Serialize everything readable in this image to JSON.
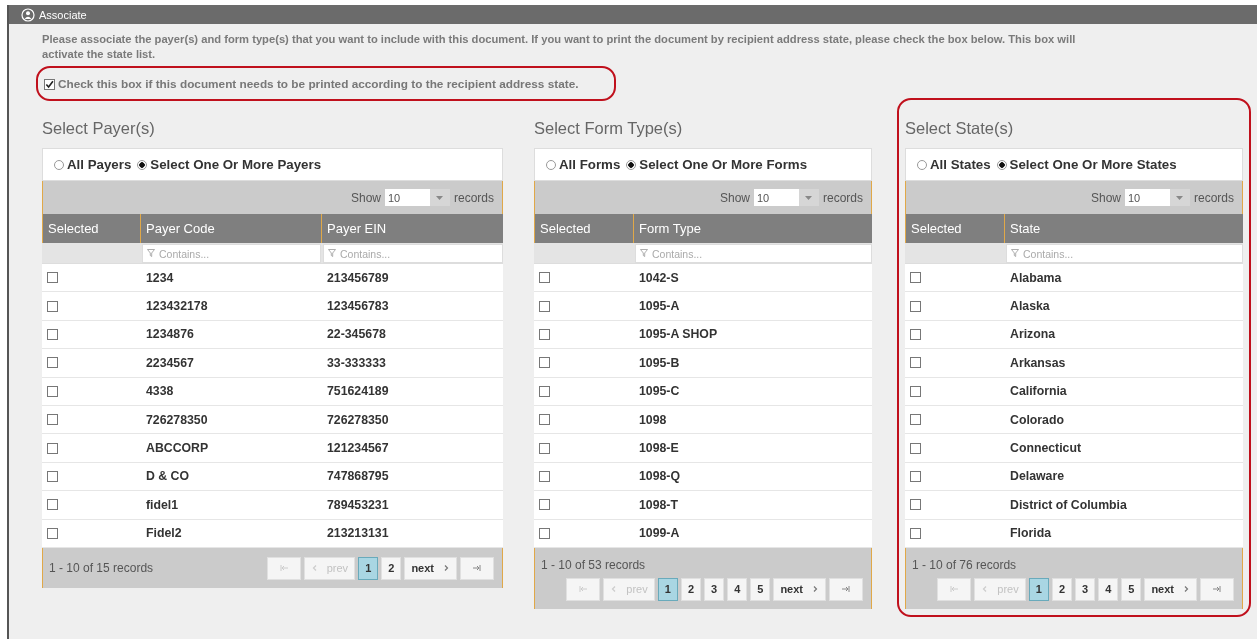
{
  "header": {
    "title": "Associate"
  },
  "instructions": "Please associate the payer(s) and form type(s) that you want to include with this document. If you want to print the document by recipient address state, please check the box below. This box will activate the state list.",
  "state_print_option": {
    "label": "Check this box if this document needs to be printed according to the recipient address state.",
    "checked": true,
    "highlighted": true
  },
  "panels": [
    {
      "title": "Select Payer(s)",
      "highlighted": false,
      "scope_options": [
        {
          "label": "All Payers",
          "selected": false
        },
        {
          "label": "Select One Or More Payers",
          "selected": true
        }
      ],
      "page_size": {
        "label": "Show",
        "value": "10",
        "suffix": "records"
      },
      "check_column": {
        "label": "Selected"
      },
      "columns": [
        {
          "label": "Payer Code",
          "kind": "text",
          "filter_placeholder": "Contains..."
        },
        {
          "label": "Payer EIN",
          "kind": "text",
          "filter_placeholder": "Contains..."
        }
      ],
      "rows": [
        {
          "checked": false,
          "cells": [
            "1234",
            "213456789"
          ]
        },
        {
          "checked": false,
          "cells": [
            "123432178",
            "123456783"
          ]
        },
        {
          "checked": false,
          "cells": [
            "1234876",
            "22-345678"
          ]
        },
        {
          "checked": false,
          "cells": [
            "2234567",
            "33-333333"
          ]
        },
        {
          "checked": false,
          "cells": [
            "4338",
            "751624189"
          ]
        },
        {
          "checked": false,
          "cells": [
            "726278350",
            "726278350"
          ]
        },
        {
          "checked": false,
          "cells": [
            "ABCCORP",
            "121234567"
          ]
        },
        {
          "checked": false,
          "cells": [
            "D & CO",
            "747868795"
          ]
        },
        {
          "checked": false,
          "cells": [
            "fidel1",
            "789453231"
          ]
        },
        {
          "checked": false,
          "cells": [
            "Fidel2",
            "213213131"
          ]
        }
      ],
      "summary": "1 - 10 of 15 records",
      "pager": [
        {
          "kind": "first",
          "disabled": true
        },
        {
          "kind": "prev",
          "label": "prev",
          "disabled": true
        },
        {
          "kind": "page",
          "label": "1",
          "selected": true
        },
        {
          "kind": "page",
          "label": "2",
          "selected": false
        },
        {
          "kind": "next",
          "label": "next",
          "disabled": false
        },
        {
          "kind": "last",
          "disabled": false
        }
      ]
    },
    {
      "title": "Select Form Type(s)",
      "highlighted": false,
      "scope_options": [
        {
          "label": "All Forms",
          "selected": false
        },
        {
          "label": "Select One Or More Forms",
          "selected": true
        }
      ],
      "page_size": {
        "label": "Show",
        "value": "10",
        "suffix": "records"
      },
      "check_column": {
        "label": "Selected"
      },
      "columns": [
        {
          "label": "Form Type",
          "kind": "text",
          "filter_placeholder": "Contains..."
        }
      ],
      "rows": [
        {
          "checked": false,
          "cells": [
            "1042-S"
          ]
        },
        {
          "checked": false,
          "cells": [
            "1095-A"
          ]
        },
        {
          "checked": false,
          "cells": [
            "1095-A SHOP"
          ]
        },
        {
          "checked": false,
          "cells": [
            "1095-B"
          ]
        },
        {
          "checked": false,
          "cells": [
            "1095-C"
          ]
        },
        {
          "checked": false,
          "cells": [
            "1098"
          ]
        },
        {
          "checked": false,
          "cells": [
            "1098-E"
          ]
        },
        {
          "checked": false,
          "cells": [
            "1098-Q"
          ]
        },
        {
          "checked": false,
          "cells": [
            "1098-T"
          ]
        },
        {
          "checked": false,
          "cells": [
            "1099-A"
          ]
        }
      ],
      "summary": "1 - 10 of 53 records",
      "pager": [
        {
          "kind": "first",
          "disabled": true
        },
        {
          "kind": "prev",
          "label": "prev",
          "disabled": true
        },
        {
          "kind": "page",
          "label": "1",
          "selected": true
        },
        {
          "kind": "page",
          "label": "2",
          "selected": false
        },
        {
          "kind": "page",
          "label": "3",
          "selected": false
        },
        {
          "kind": "page",
          "label": "4",
          "selected": false
        },
        {
          "kind": "page",
          "label": "5",
          "selected": false
        },
        {
          "kind": "next",
          "label": "next",
          "disabled": false
        },
        {
          "kind": "last",
          "disabled": false
        }
      ]
    },
    {
      "title": "Select State(s)",
      "highlighted": true,
      "scope_options": [
        {
          "label": "All States",
          "selected": false
        },
        {
          "label": "Select One Or More States",
          "selected": true
        }
      ],
      "page_size": {
        "label": "Show",
        "value": "10",
        "suffix": "records"
      },
      "check_column": {
        "label": "Selected"
      },
      "columns": [
        {
          "label": "State",
          "kind": "text",
          "filter_placeholder": "Contains..."
        }
      ],
      "rows": [
        {
          "checked": false,
          "cells": [
            "Alabama"
          ]
        },
        {
          "checked": false,
          "cells": [
            "Alaska"
          ]
        },
        {
          "checked": false,
          "cells": [
            "Arizona"
          ]
        },
        {
          "checked": false,
          "cells": [
            "Arkansas"
          ]
        },
        {
          "checked": false,
          "cells": [
            "California"
          ]
        },
        {
          "checked": false,
          "cells": [
            "Colorado"
          ]
        },
        {
          "checked": false,
          "cells": [
            "Connecticut"
          ]
        },
        {
          "checked": false,
          "cells": [
            "Delaware"
          ]
        },
        {
          "checked": false,
          "cells": [
            "District of Columbia"
          ]
        },
        {
          "checked": false,
          "cells": [
            "Florida"
          ]
        }
      ],
      "summary": "1 - 10 of 76 records",
      "pager": [
        {
          "kind": "first",
          "disabled": true
        },
        {
          "kind": "prev",
          "label": "prev",
          "disabled": true
        },
        {
          "kind": "page",
          "label": "1",
          "selected": true
        },
        {
          "kind": "page",
          "label": "2",
          "selected": false
        },
        {
          "kind": "page",
          "label": "3",
          "selected": false
        },
        {
          "kind": "page",
          "label": "4",
          "selected": false
        },
        {
          "kind": "page",
          "label": "5",
          "selected": false
        },
        {
          "kind": "next",
          "label": "next",
          "disabled": false
        },
        {
          "kind": "last",
          "disabled": false
        }
      ]
    }
  ]
}
